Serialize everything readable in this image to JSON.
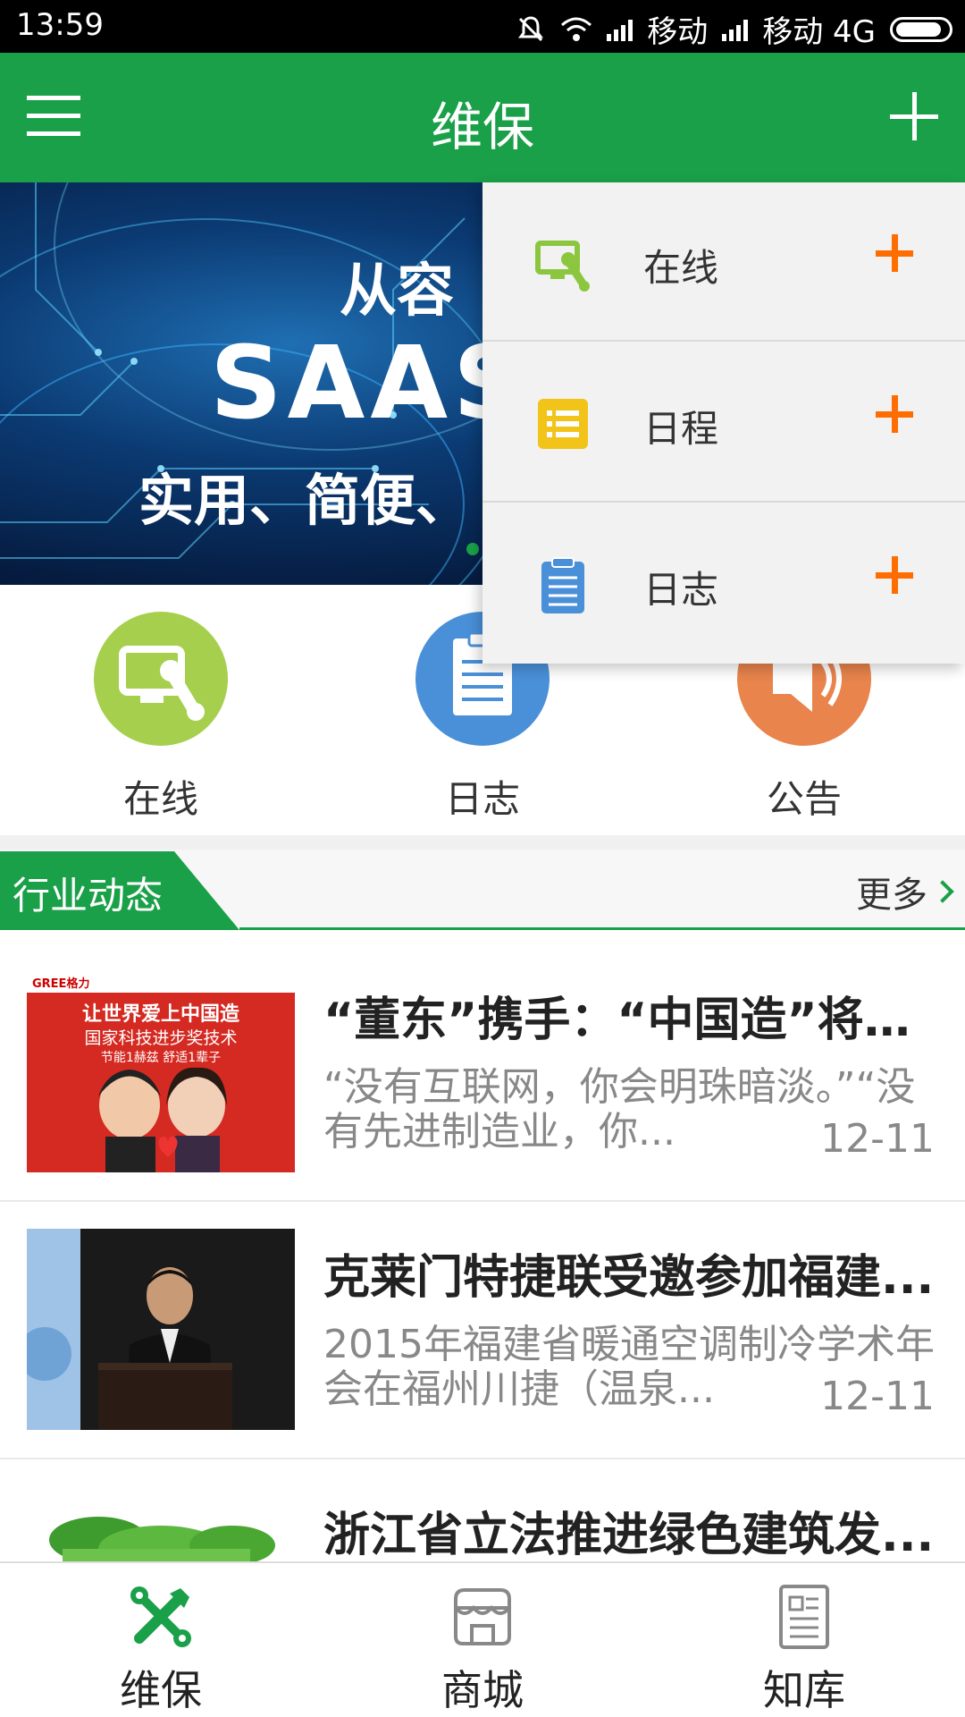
{
  "status_bar": {
    "time": "13:59",
    "carrier1": "移动",
    "carrier2": "移动 4G"
  },
  "app_bar": {
    "title": "维保"
  },
  "banner": {
    "line1": "从容",
    "line2": "SAAS",
    "line3": "实用、简便、"
  },
  "shortcuts": [
    {
      "label": "在线",
      "color": "#a5cf4c",
      "icon": "online-repair-icon"
    },
    {
      "label": "日志",
      "color": "#4a90d9",
      "icon": "log-clipboard-icon"
    },
    {
      "label": "公告",
      "color": "#e8844c",
      "icon": "announcement-speaker-icon"
    }
  ],
  "section": {
    "title": "行业动态",
    "more": "更多"
  },
  "news": [
    {
      "title": "“董东”携手：“中国造”将如...",
      "summary": "“没有互联网，你会明珠暗淡。”“没有先进制造业，你...",
      "date": "12-11",
      "thumb_texts": [
        "GREE格力",
        "让世界爱上中国造",
        "国家科技进步奖技术",
        "节能1赫兹 舒适1辈子"
      ]
    },
    {
      "title": "克莱门特捷联受邀参加福建...",
      "summary": "2015年福建省暖通空调制冷学术年会在福州川捷（温泉...",
      "date": "12-11"
    },
    {
      "title": "浙江省立法推进绿色建筑发...",
      "summary": "",
      "date": ""
    }
  ],
  "bottom_nav": [
    {
      "label": "维保",
      "icon": "tools-icon",
      "active": true
    },
    {
      "label": "商城",
      "icon": "store-icon",
      "active": false
    },
    {
      "label": "知库",
      "icon": "document-icon",
      "active": false
    }
  ],
  "dropdown": [
    {
      "label": "在线",
      "icon": "online-repair-icon",
      "icon_color": "#8cc63e"
    },
    {
      "label": "日程",
      "icon": "schedule-list-icon",
      "icon_color": "#f2c318"
    },
    {
      "label": "日志",
      "icon": "log-clipboard-icon",
      "icon_color": "#4a90d9"
    }
  ],
  "colors": {
    "brand_green": "#1aa048",
    "accent_orange": "#ff6d00"
  }
}
